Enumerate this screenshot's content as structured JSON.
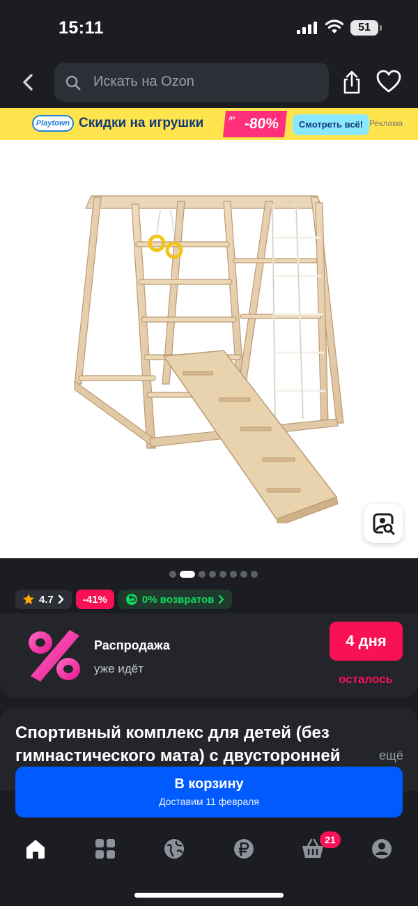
{
  "status_bar": {
    "time": "15:11",
    "battery": "51"
  },
  "header": {
    "search_placeholder": "Искать на Ozon",
    "icons": [
      "back-arrow-icon",
      "search-icon",
      "share-icon",
      "heart-icon"
    ]
  },
  "ad_banner": {
    "brand": "Playtown",
    "headline": "Скидки на игрушки",
    "discount_prefix": "до",
    "discount": "-80%",
    "cta": "Смотреть всё!",
    "label": "Реклама"
  },
  "gallery": {
    "image_count": 8,
    "active_index": 1
  },
  "chips": {
    "rating": "4.7",
    "discount": "-41%",
    "returns": "0% возвратов"
  },
  "promo": {
    "title": "Распродажа",
    "subtitle": "уже идёт",
    "timer": "4 дня",
    "timer_suffix": "осталось"
  },
  "product": {
    "title": "Спортивный комплекс для детей (без гимнастического мата) с двусторонней",
    "more": "ещё"
  },
  "cart_button": {
    "label": "В корзину",
    "delivery": "Доставим 11 февраля"
  },
  "tabbar": {
    "tabs": [
      "home-icon",
      "catalog-icon",
      "fresh-icon",
      "finance-icon",
      "cart-icon",
      "profile-icon"
    ],
    "cart_badge": "21"
  },
  "colors": {
    "background": "#1b1d22",
    "card": "#23252b",
    "accent_blue": "#005bff",
    "accent_pink": "#f91155",
    "green": "#10d861",
    "banner_yellow": "#ffe44d"
  }
}
